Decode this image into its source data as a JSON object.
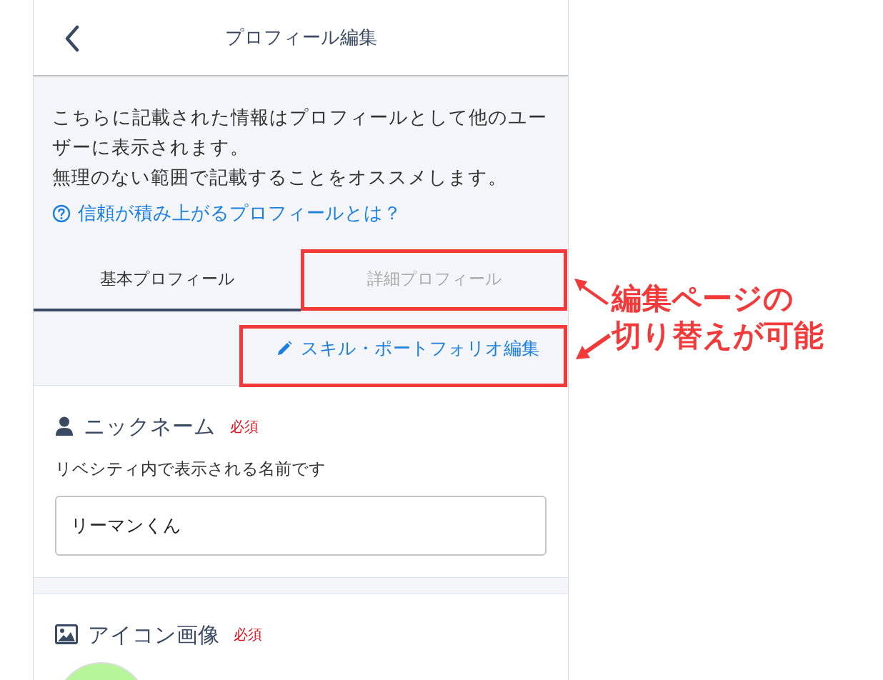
{
  "header": {
    "title": "プロフィール編集"
  },
  "intro": [
    "こちらに記載された情報はプロフィールとして他のユーザーに表示されます。",
    "無理のない範囲で記載することをオススメします。"
  ],
  "help_link": "信頼が積み上がるプロフィールとは？",
  "tabs": [
    {
      "label": "基本プロフィール",
      "selected": true
    },
    {
      "label": "詳細プロフィール",
      "selected": false
    }
  ],
  "skill_button": "スキル・ポートフォリオ編集",
  "sections": [
    {
      "kind": "text",
      "title": "ニックネーム",
      "badge": "必須",
      "description": "リベシティ内で表示される名前です",
      "value": "リーマンくん"
    },
    {
      "kind": "image",
      "title": "アイコン画像",
      "badge": "必須"
    }
  ],
  "annotation": {
    "lines": [
      "編集ページの",
      "切り替えが可能"
    ]
  }
}
